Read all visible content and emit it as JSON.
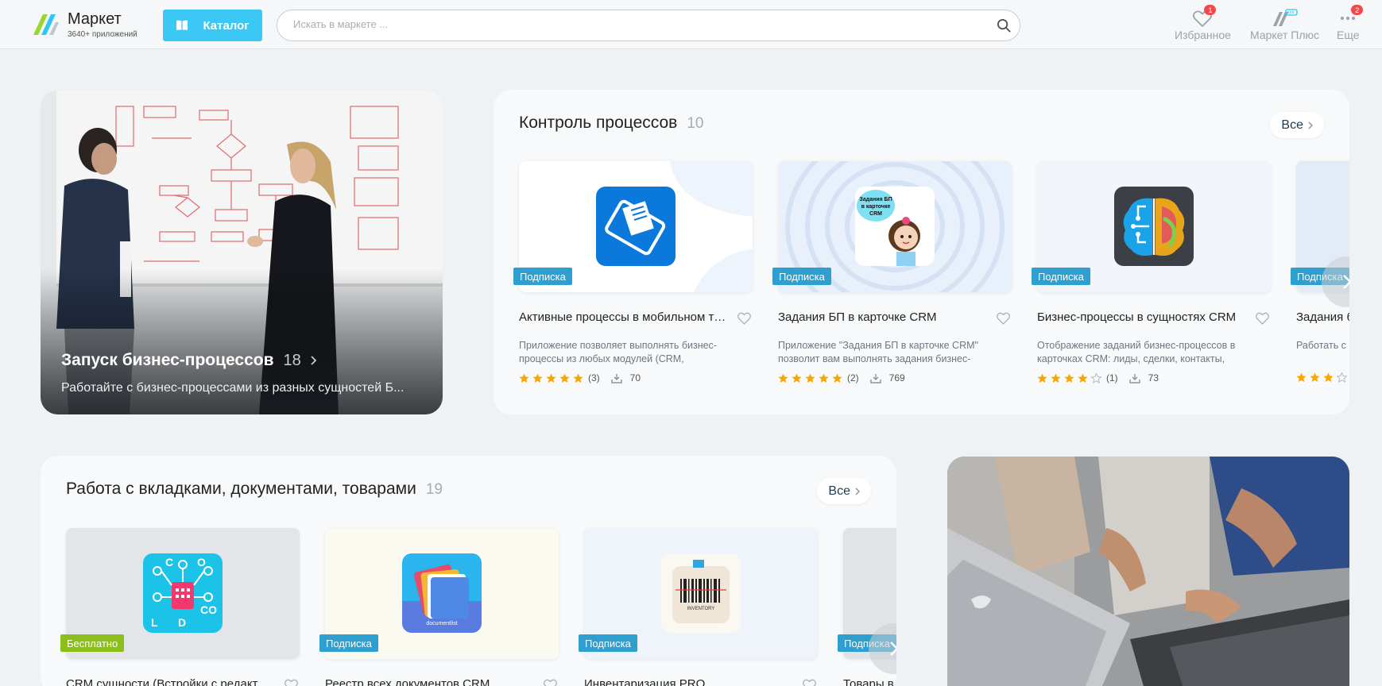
{
  "header": {
    "brand_title": "Маркет",
    "brand_subtitle": "3640+ приложений",
    "catalog_label": "Каталог",
    "search_placeholder": "Искать в маркете ...",
    "nav": [
      {
        "label": "Избранное",
        "badge": "1",
        "icon": "heart-icon"
      },
      {
        "label": "Маркет Плюс",
        "badge": "",
        "icon": "market-plus-icon"
      },
      {
        "label": "Еще",
        "badge": "2",
        "icon": "more-icon"
      }
    ]
  },
  "promo_top": {
    "title": "Запуск бизнес-процессов",
    "count": "18",
    "text": "Работайте с бизнес-процессами из разных сущностей Б..."
  },
  "section_process": {
    "title": "Контроль процессов",
    "count": "10",
    "all_label": "Все",
    "apps": [
      {
        "name": "Активные процессы в мобильном тел...",
        "tag": "Подписка",
        "desc": "Приложение позволяет выполнять бизнес-процессы из любых модулей (CRM, Универсальные списки,...",
        "rating": 5,
        "reviews": "(3)",
        "installs": "70",
        "icon": "tablet-docs-icon"
      },
      {
        "name": "Задания БП в карточке CRM",
        "tag": "Подписка",
        "desc": "Приложение \"Задания БП в карточке CRM\" позволит вам выполнять задания бизнес-процессов,...",
        "rating": 5,
        "reviews": "(2)",
        "installs": "769",
        "icon": "girl-bubble-icon",
        "icon_text": "Задания БП в карточке CRM"
      },
      {
        "name": "Бизнес-процессы в сущностях CRM",
        "tag": "Подписка",
        "desc": "Отображение заданий бизнес-процессов в карточках CRM: лиды, сделки, контакты, компании,...",
        "rating": 4,
        "reviews": "(1)",
        "installs": "73",
        "icon": "brain-circuit-icon"
      },
      {
        "name": "Задания б",
        "tag": "Подписка",
        "desc": "Работать с б удобнее, есл",
        "rating": 3,
        "reviews": "",
        "installs": "",
        "icon": ""
      }
    ]
  },
  "section_tabs": {
    "title": "Работа с вкладками, документами, товарами",
    "count": "19",
    "all_label": "Все",
    "apps": [
      {
        "name": "CRM сущности (Встройки с редактиро...",
        "tag": "Бесплатно",
        "tag_type": "free",
        "icon": "crm-entities-icon"
      },
      {
        "name": "Реестр всех документов CRM",
        "tag": "Подписка",
        "tag_type": "sub",
        "icon": "documentlist-icon",
        "icon_text": "documentlist"
      },
      {
        "name": "Инвентаризация PRO",
        "tag": "Подписка",
        "tag_type": "sub",
        "icon": "barcode-inventory-icon",
        "icon_text": "INVENTORY"
      },
      {
        "name": "Товары в",
        "tag": "Подписка",
        "tag_type": "sub",
        "icon": ""
      }
    ]
  },
  "colors": {
    "accent": "#3bc8f5",
    "tag_sub": "#2e9fcf",
    "tag_free": "#8cbf1c",
    "star": "#f7a700",
    "badge": "#f24a4a"
  }
}
